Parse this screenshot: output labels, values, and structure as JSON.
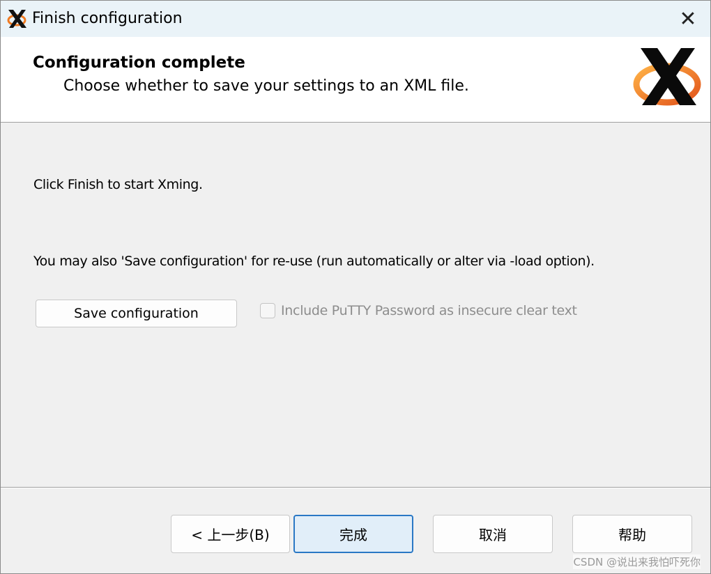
{
  "window": {
    "title": "Finish configuration",
    "close_label": "✕"
  },
  "header": {
    "title": "Configuration complete",
    "subtitle": "Choose whether to save your settings to an XML file."
  },
  "body": {
    "line1": "Click Finish to start Xming.",
    "line2": "You may also 'Save configuration' for re-use (run automatically or alter via -load option).",
    "save_button": "Save configuration",
    "checkbox_label": "Include PuTTY Password as insecure clear text",
    "checkbox_checked": false,
    "checkbox_enabled": false
  },
  "footer": {
    "back_label": "< 上一步(B)",
    "finish_label": "完成",
    "cancel_label": "取消",
    "help_label": "帮助"
  },
  "watermark": "CSDN @说出来我怕吓死你",
  "colors": {
    "titlebar_bg": "#eaf3f8",
    "finish_border": "#2a78c5",
    "logo_orange": "#f07a21"
  }
}
